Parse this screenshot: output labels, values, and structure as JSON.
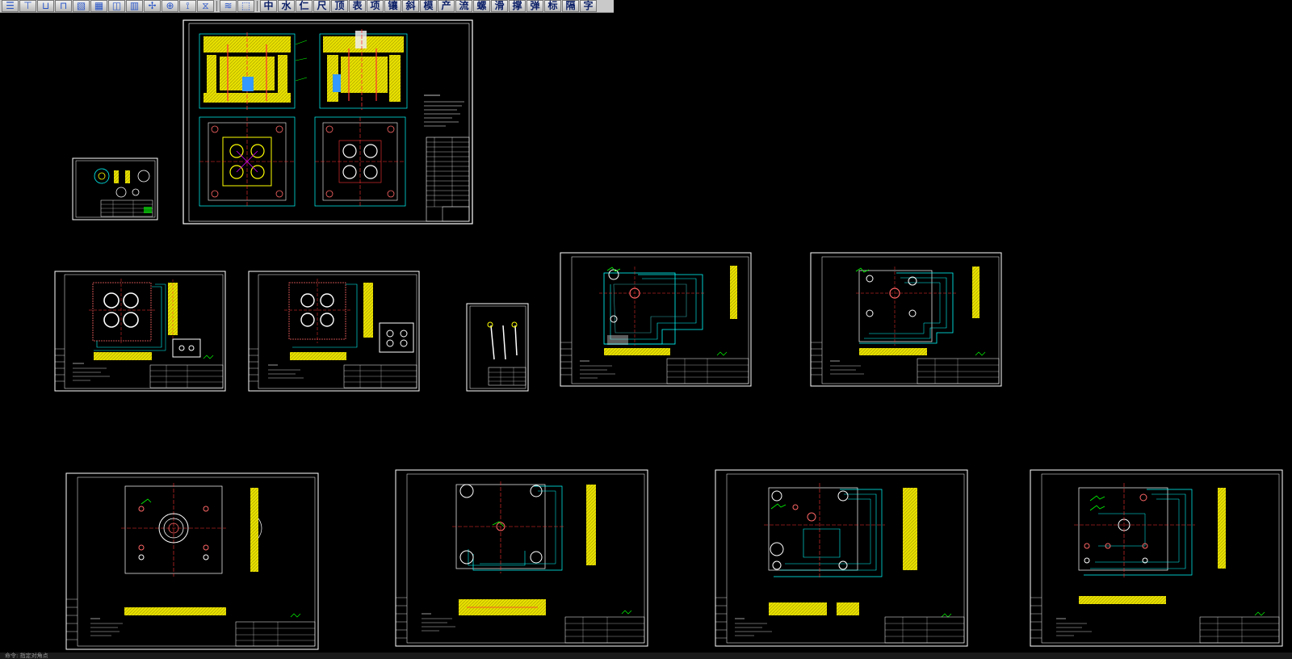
{
  "toolbar": {
    "icons": [
      {
        "name": "layer-manager-icon",
        "glyph": "☰"
      },
      {
        "name": "dimension-icon",
        "glyph": "⊤"
      },
      {
        "name": "hole-icon",
        "glyph": "⊔"
      },
      {
        "name": "insert-icon",
        "glyph": "⊓"
      },
      {
        "name": "pattern-icon",
        "glyph": "▧"
      },
      {
        "name": "block-icon",
        "glyph": "▦"
      },
      {
        "name": "section-icon",
        "glyph": "◫"
      },
      {
        "name": "detail-icon",
        "glyph": "▥"
      },
      {
        "name": "snap-icon",
        "glyph": "✢"
      },
      {
        "name": "center-icon",
        "glyph": "⊕"
      },
      {
        "name": "screw-icon",
        "glyph": "⟟"
      },
      {
        "name": "spring-icon",
        "glyph": "⧖"
      },
      {
        "name": "layer-stack-icon",
        "glyph": "≋"
      },
      {
        "name": "layer-swap-icon",
        "glyph": "⬚"
      }
    ],
    "text_buttons": [
      "中",
      "水",
      "仁",
      "尺",
      "顶",
      "表",
      "项",
      "镶",
      "斜",
      "模",
      "产",
      "流",
      "螺",
      "滑",
      "撑",
      "弹",
      "标",
      "隔",
      "字"
    ]
  },
  "status_text": "命令: 指定对角点"
}
